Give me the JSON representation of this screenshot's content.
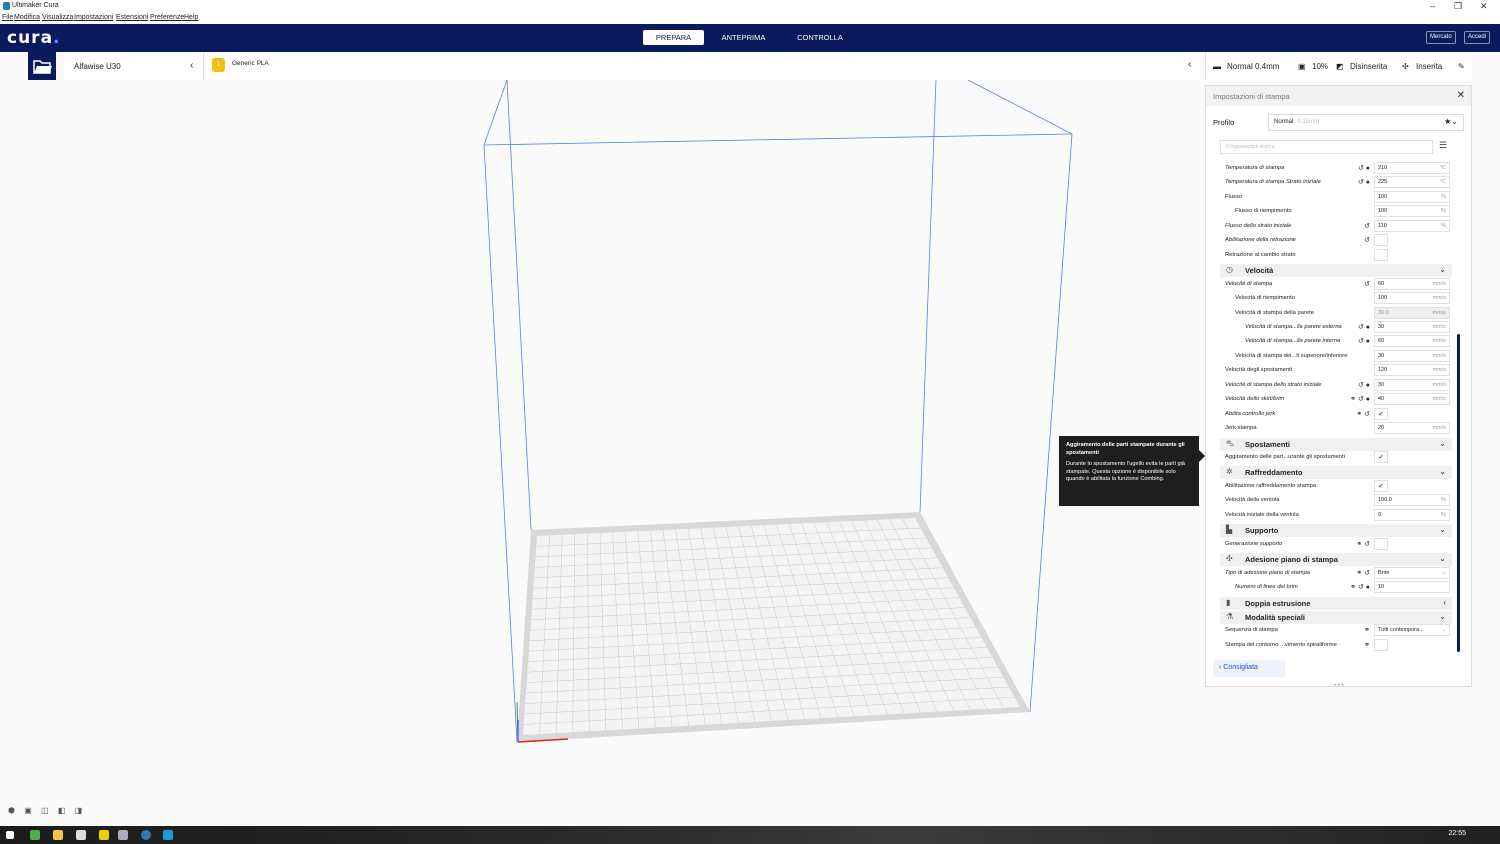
{
  "window": {
    "title": "Ultimaker Cura",
    "controls": [
      "–",
      "❐",
      "✕"
    ]
  },
  "menu": [
    "File",
    "Modifica",
    "Visualizza",
    "Impostazioni",
    "Estensioni",
    "Preferenze",
    "Help"
  ],
  "header": {
    "logo": "cura",
    "tabs": [
      "PREPARA",
      "ANTEPRIMA",
      "CONTROLLA"
    ],
    "active_tab": "PREPARA",
    "marketplace": "Mercato",
    "signin": "Accedi"
  },
  "printer": {
    "name": "Alfawise U30",
    "chevron": "‹"
  },
  "material": {
    "badge": "1",
    "name": "Generic PLA"
  },
  "print_summary": {
    "profile": "Normal 0.4mm",
    "infill": "10%",
    "support": "Disinserita",
    "adhesion": "Inserita"
  },
  "panel": {
    "title": "Impostazioni di stampa",
    "profile_label": "Profilo",
    "profile_value": "Normal",
    "profile_sub": "0.15mm",
    "search_placeholder": "Impostazioni ricerca",
    "recommended": "Consigliata",
    "rows": [
      {
        "label": "Temperatura di stampa",
        "italic": true,
        "icons": "↺ ●",
        "value": "210",
        "unit": "°C",
        "type": "val"
      },
      {
        "label": "Temperatura di stampa Strato iniziale",
        "italic": true,
        "icons": "↺ ●",
        "value": "225",
        "unit": "°C",
        "type": "val"
      },
      {
        "label": "Flusso",
        "italic": false,
        "icons": "",
        "value": "100",
        "unit": "%",
        "type": "val"
      },
      {
        "label": "Flusso di riempimento",
        "italic": false,
        "indent": 1,
        "icons": "",
        "value": "100",
        "unit": "%",
        "type": "val"
      },
      {
        "label": "Flusso dello strato iniziale",
        "italic": true,
        "icons": "↺",
        "value": "110",
        "unit": "%",
        "type": "val"
      },
      {
        "label": "Abilitazione della retrazione",
        "italic": true,
        "icons": "↺",
        "value": "",
        "type": "chk"
      },
      {
        "label": "Retrazione al cambio strato",
        "italic": false,
        "icons": "",
        "value": "",
        "type": "chk"
      },
      {
        "category": "Velocità",
        "icon": "◷",
        "chev": "⌄"
      },
      {
        "label": "Velocità di stampa",
        "italic": true,
        "icons": "↺",
        "value": "60",
        "unit": "mm/s",
        "type": "val"
      },
      {
        "label": "Velocità di riempimento",
        "italic": false,
        "indent": 1,
        "icons": "",
        "value": "100",
        "unit": "mm/s",
        "type": "val"
      },
      {
        "label": "Velocità di stampa della parete",
        "italic": false,
        "indent": 1,
        "icons": "",
        "value": "30.0",
        "unit": "mm/s",
        "type": "val",
        "disabled": true
      },
      {
        "label": "Velocità di stampa...lla parete esterna",
        "italic": true,
        "indent": 2,
        "icons": "↺ ●",
        "value": "30",
        "unit": "mm/s",
        "type": "val"
      },
      {
        "label": "Velocità di stampa...lla parete interna",
        "italic": true,
        "indent": 2,
        "icons": "↺ ●",
        "value": "60",
        "unit": "mm/s",
        "type": "val"
      },
      {
        "label": "Velocità di stampa del...ti superiore/inferiore",
        "italic": false,
        "indent": 1,
        "icons": "",
        "value": "30",
        "unit": "mm/s",
        "type": "val"
      },
      {
        "label": "Velocità degli spostamenti",
        "italic": false,
        "icons": "",
        "value": "120",
        "unit": "mm/s",
        "type": "val"
      },
      {
        "label": "Velocità di stampa dello strato iniziale",
        "italic": true,
        "icons": "↺ ●",
        "value": "30",
        "unit": "mm/s",
        "type": "val"
      },
      {
        "label": "Velocità dello skirt/brim",
        "italic": true,
        "icons": "⚭ ↺ ●",
        "value": "40",
        "unit": "mm/s",
        "type": "val"
      },
      {
        "label": "Abilita controllo jerk",
        "italic": true,
        "icons": "⚭ ↺",
        "value": "✓",
        "type": "chk"
      },
      {
        "label": "Jerk stampa",
        "italic": false,
        "icons": "",
        "value": "20",
        "unit": "mm/s",
        "type": "val"
      },
      {
        "category": "Spostamenti",
        "icon": "⛍",
        "chev": "⌄"
      },
      {
        "label": "Aggiramento delle part...urante gli spostamenti",
        "italic": false,
        "icons": "",
        "value": "✓",
        "type": "chk"
      },
      {
        "category": "Raffreddamento",
        "icon": "✲",
        "chev": "⌄"
      },
      {
        "label": "Abilitazione raffreddamento stampa",
        "italic": false,
        "icons": "",
        "value": "✓",
        "type": "chk"
      },
      {
        "label": "Velocità della ventola",
        "italic": false,
        "icons": "",
        "value": "100.0",
        "unit": "%",
        "type": "val"
      },
      {
        "label": "Velocità iniziale della ventola",
        "italic": false,
        "icons": "",
        "value": "0",
        "unit": "%",
        "type": "val"
      },
      {
        "category": "Supporto",
        "icon": "▙",
        "chev": "⌄"
      },
      {
        "label": "Generazione supporto",
        "italic": true,
        "icons": "⚭ ↺",
        "value": "",
        "type": "chk"
      },
      {
        "category": "Adesione piano di stampa",
        "icon": "✣",
        "chev": "⌄"
      },
      {
        "label": "Tipo di adesione piano di stampa",
        "italic": true,
        "icons": "⚭ ↺",
        "value": "Brim",
        "unit": "⌄",
        "type": "val"
      },
      {
        "label": "Numero di linee del brim",
        "italic": true,
        "indent": 1,
        "icons": "⚭ ↺ ●",
        "value": "10",
        "unit": "",
        "type": "val"
      },
      {
        "category": "Doppia estrusione",
        "icon": "▮",
        "chev": "‹"
      },
      {
        "category": "Modalità speciali",
        "icon": "⚗",
        "chev": "⌄"
      },
      {
        "label": "Sequenza di stampa",
        "italic": false,
        "icons": "⚭",
        "value": "Tutti contempora...",
        "unit": "⌄",
        "type": "val"
      },
      {
        "label": "Stampa del contorno ...vimento spiraliforme",
        "italic": false,
        "icons": "⚭",
        "value": "",
        "type": "chk"
      }
    ]
  },
  "tooltip": {
    "title": "Aggiramento delle parti stampate durante gli spostamenti",
    "body": "Durante lo spostamento l'ugello evita le parti già stampate. Questa opzione è disponibile solo quando è abilitata la funzione Combing."
  },
  "taskbar": {
    "time": "22:55"
  },
  "colors": {
    "header": "#0a1a5c",
    "accent": "#1a4fd8",
    "tooltip": "#1e1e1e"
  }
}
